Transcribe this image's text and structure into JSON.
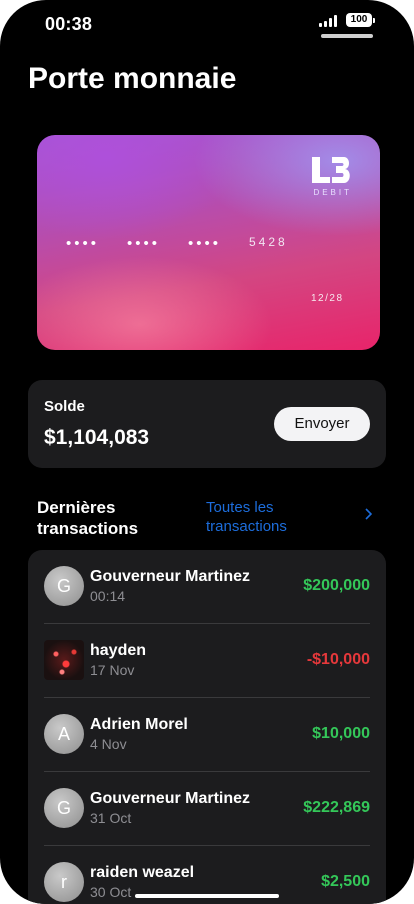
{
  "status_bar": {
    "time": "00:38",
    "battery": "100"
  },
  "page_title": "Porte monnaie",
  "card": {
    "brand_sub": "DEBIT",
    "masked_groups": [
      "••••",
      "••••",
      "••••"
    ],
    "last4": "5428",
    "expiry": "12/28"
  },
  "balance": {
    "label": "Solde",
    "amount": "$1,104,083",
    "send_label": "Envoyer"
  },
  "transactions_section": {
    "title": "Dernières transactions",
    "all_link": "Toutes les transactions"
  },
  "transactions": [
    {
      "initial": "G",
      "name": "Gouverneur Martinez",
      "date": "00:14",
      "amount": "$200,000",
      "direction": "in"
    },
    {
      "initial": "",
      "name": "hayden",
      "date": "17 Nov",
      "amount": "-$10,000",
      "direction": "out"
    },
    {
      "initial": "A",
      "name": "Adrien Morel",
      "date": "4 Nov",
      "amount": "$10,000",
      "direction": "in"
    },
    {
      "initial": "G",
      "name": "Gouverneur Martinez",
      "date": "31 Oct",
      "amount": "$222,869",
      "direction": "in"
    },
    {
      "initial": "r",
      "name": "raiden weazel",
      "date": "30 Oct",
      "amount": "$2,500",
      "direction": "in"
    }
  ],
  "colors": {
    "positive": "#34c759",
    "negative": "#e5383b",
    "link": "#1d6ddb"
  }
}
